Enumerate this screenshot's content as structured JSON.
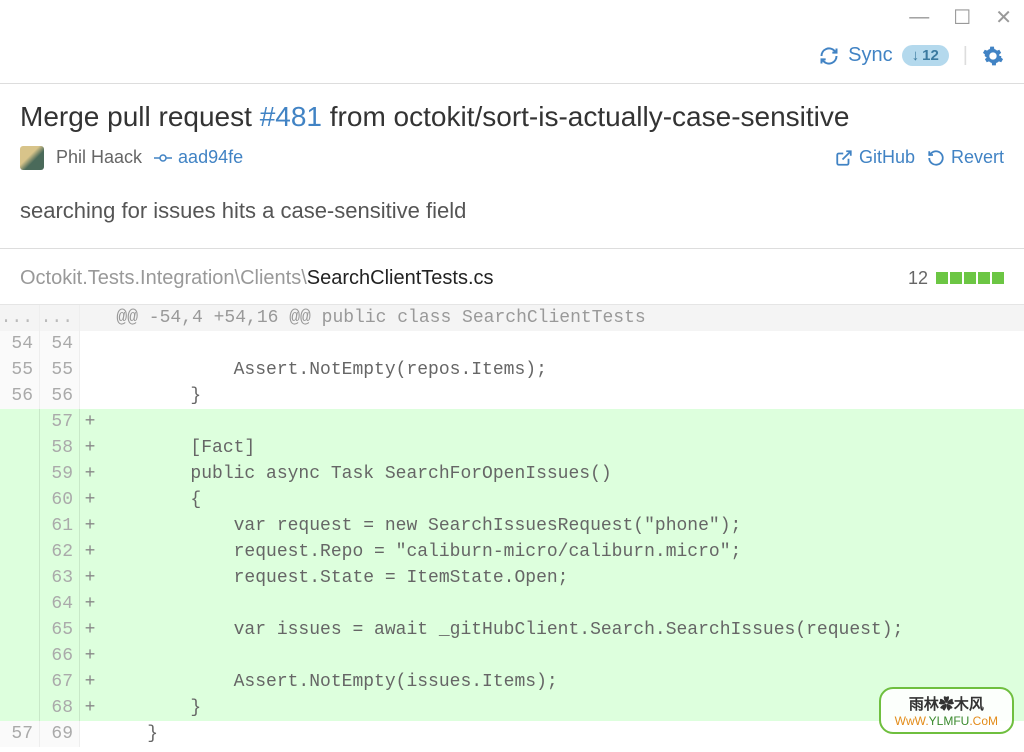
{
  "toolbar": {
    "sync_label": "Sync",
    "badge_arrow": "↓",
    "badge_count": "12"
  },
  "commit": {
    "title_prefix": "Merge pull request ",
    "pr_number": "#481",
    "title_suffix": " from octokit/sort-is-actually-case-sensitive",
    "author": "Phil Haack",
    "sha": "aad94fe",
    "github_label": "GitHub",
    "revert_label": "Revert",
    "description": "searching for issues hits a case-sensitive field"
  },
  "file": {
    "path_dim": "Octokit.Tests.Integration\\Clients\\",
    "filename": "SearchClientTests.cs",
    "stat_count": "12"
  },
  "diff": {
    "rows": [
      {
        "type": "hunk",
        "l": "...",
        "r": "...",
        "sign": "",
        "code": "   @@ -54,4 +54,16 @@ public class SearchClientTests"
      },
      {
        "type": "ctx",
        "l": "54",
        "r": "54",
        "sign": "",
        "code": ""
      },
      {
        "type": "ctx",
        "l": "55",
        "r": "55",
        "sign": "",
        "code": "            Assert.NotEmpty(repos.Items);"
      },
      {
        "type": "ctx",
        "l": "56",
        "r": "56",
        "sign": "",
        "code": "        }"
      },
      {
        "type": "add",
        "l": "",
        "r": "57",
        "sign": "+",
        "code": ""
      },
      {
        "type": "add",
        "l": "",
        "r": "58",
        "sign": "+",
        "code": "        [Fact]"
      },
      {
        "type": "add",
        "l": "",
        "r": "59",
        "sign": "+",
        "code": "        public async Task SearchForOpenIssues()"
      },
      {
        "type": "add",
        "l": "",
        "r": "60",
        "sign": "+",
        "code": "        {"
      },
      {
        "type": "add",
        "l": "",
        "r": "61",
        "sign": "+",
        "code": "            var request = new SearchIssuesRequest(\"phone\");"
      },
      {
        "type": "add",
        "l": "",
        "r": "62",
        "sign": "+",
        "code": "            request.Repo = \"caliburn-micro/caliburn.micro\";"
      },
      {
        "type": "add",
        "l": "",
        "r": "63",
        "sign": "+",
        "code": "            request.State = ItemState.Open;"
      },
      {
        "type": "add",
        "l": "",
        "r": "64",
        "sign": "+",
        "code": ""
      },
      {
        "type": "add",
        "l": "",
        "r": "65",
        "sign": "+",
        "code": "            var issues = await _gitHubClient.Search.SearchIssues(request);"
      },
      {
        "type": "add",
        "l": "",
        "r": "66",
        "sign": "+",
        "code": ""
      },
      {
        "type": "add",
        "l": "",
        "r": "67",
        "sign": "+",
        "code": "            Assert.NotEmpty(issues.Items);"
      },
      {
        "type": "add",
        "l": "",
        "r": "68",
        "sign": "+",
        "code": "        }"
      },
      {
        "type": "ctx",
        "l": "57",
        "r": "69",
        "sign": "",
        "code": "    }"
      }
    ]
  },
  "watermark": {
    "top": "雨林✿木风",
    "bot_left": "WwW.",
    "bot_mid": "YLMFU",
    "bot_right": ".CoM"
  }
}
